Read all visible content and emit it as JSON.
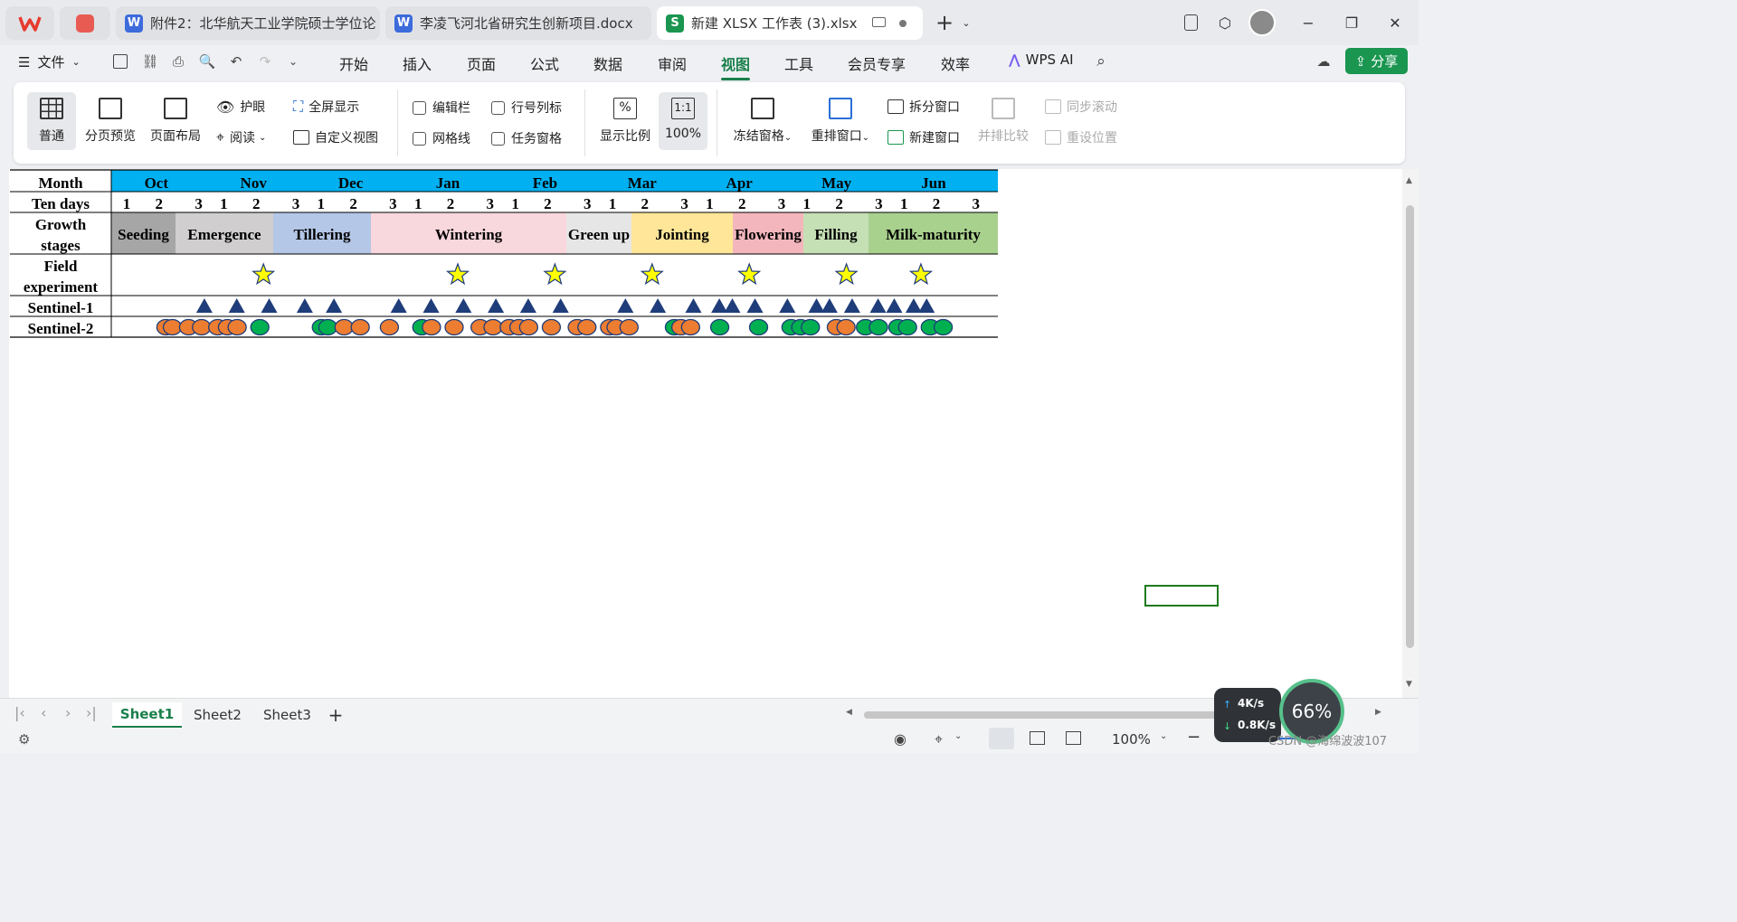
{
  "titlebar": {
    "tabs": [
      {
        "icon": "W",
        "icon_color": "#3d6bdc",
        "label": "附件2：北华航天工业学院硕士学位论"
      },
      {
        "icon": "W",
        "icon_color": "#3d6bdc",
        "label": "李凌飞河北省研究生创新项目.docx"
      },
      {
        "icon": "S",
        "icon_color": "#1a9650",
        "label": "新建 XLSX 工作表 (3).xlsx"
      }
    ],
    "new_tab": "+",
    "minimize": "−",
    "restore": "❐",
    "close": "✕"
  },
  "menu": {
    "file": "文件",
    "items": [
      "开始",
      "插入",
      "页面",
      "公式",
      "数据",
      "审阅",
      "视图",
      "工具",
      "会员专享",
      "效率"
    ],
    "active": "视图",
    "wps_ai": "WPS AI",
    "share": "分享"
  },
  "ribbon": {
    "normal": "普通",
    "page_break": "分页预览",
    "page_layout": "页面布局",
    "eye_care": "护眼",
    "reading": "阅读",
    "fullscreen": "全屏显示",
    "custom_view": "自定义视图",
    "formula_bar": "编辑栏",
    "gridlines": "网格线",
    "headings": "行号列标",
    "task_pane": "任务窗格",
    "zoom": "显示比例",
    "zoom_100": "100%",
    "freeze": "冻结窗格",
    "arrange": "重排窗口",
    "split": "拆分窗口",
    "new_window": "新建窗口",
    "side_by_side": "并排比较",
    "sync_scroll": "同步滚动",
    "reset_position": "重设位置"
  },
  "chart_data": {
    "type": "table",
    "row_labels": [
      "Month",
      "Ten days",
      "Growth stages",
      "Field experiment",
      "Sentinel-1",
      "Sentinel-2"
    ],
    "months": [
      "Oct",
      "Nov",
      "Dec",
      "Jan",
      "Feb",
      "Mar",
      "Apr",
      "May",
      "Jun"
    ],
    "ten_days": [
      1,
      2,
      3,
      1,
      2,
      3,
      1,
      2,
      3,
      1,
      2,
      3,
      1,
      2,
      3,
      1,
      2,
      3,
      1,
      2,
      3,
      1,
      2,
      3,
      1,
      2,
      3
    ],
    "stages": [
      {
        "label": "Seeding",
        "color": "#a6a6a6"
      },
      {
        "label": "Emergence",
        "color": "#d0cece"
      },
      {
        "label": "Tillering",
        "color": "#b4c7e7"
      },
      {
        "label": "Wintering",
        "color": "#f8d7dd"
      },
      {
        "label": "Green up",
        "color": "#e6e6e6"
      },
      {
        "label": "Jointing",
        "color": "#ffe699"
      },
      {
        "label": "Flowering",
        "color": "#f4b6bd"
      },
      {
        "label": "Filling",
        "color": "#c5e0b4"
      },
      {
        "label": "Milk-maturity",
        "color": "#a9d18e"
      }
    ],
    "colors": {
      "month_header": "#00b0f0",
      "star": "#ffff00",
      "triangle": "#1f3d7a",
      "orange": "#ed7d31",
      "green": "#00b050"
    }
  },
  "sheets": [
    "Sheet1",
    "Sheet2",
    "Sheet3"
  ],
  "active_sheet": "Sheet1",
  "add_sheet": "+",
  "status": {
    "zoom": "100%",
    "net_up": "4K/s",
    "net_down": "0.8K/s",
    "cpu": "66%",
    "watermark": "CSDN @海绵波波107"
  }
}
